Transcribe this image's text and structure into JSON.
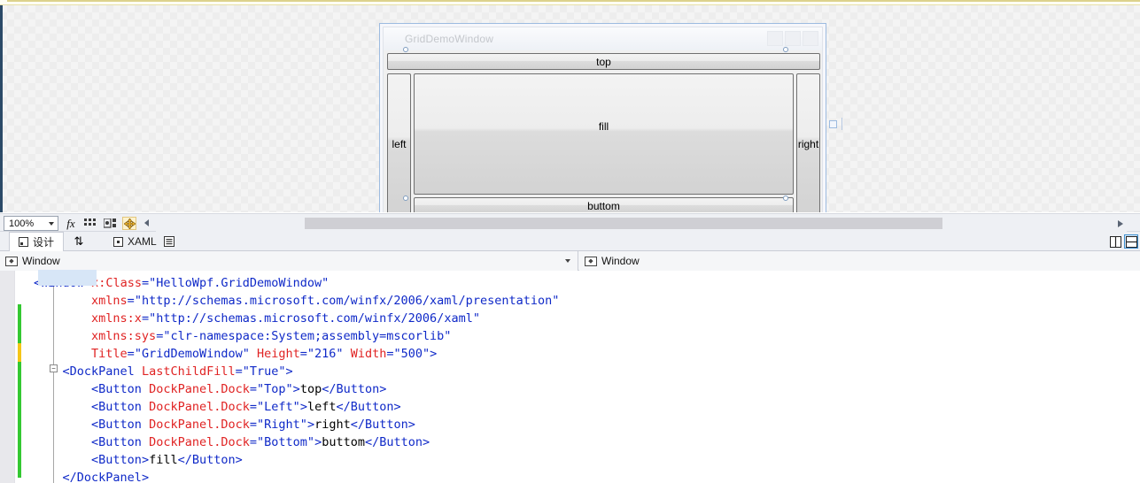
{
  "designer": {
    "window_title": "GridDemoWindow",
    "buttons": {
      "top": "top",
      "left": "left",
      "right": "right",
      "bottom": "buttom",
      "fill": "fill"
    }
  },
  "toolbar": {
    "zoom_value": "100%",
    "icons": [
      {
        "name": "fx-icon",
        "glyph": "fx"
      },
      {
        "name": "grid-icon",
        "glyph": "▒"
      },
      {
        "name": "snapping-icon",
        "glyph": "▨"
      },
      {
        "name": "alignment-icon",
        "glyph": "✧"
      }
    ],
    "overflow_label": "◂"
  },
  "tabs": {
    "design_label": "设计",
    "xaml_label": "XAML",
    "swap_label": "⇅",
    "outline_label": "▤",
    "split_vertical_label": "|",
    "split_horizontal_label": "—"
  },
  "navbar": {
    "left_value": "Window",
    "right_value": "Window"
  },
  "code": {
    "lines": [
      [
        {
          "t": "punct",
          "s": "<"
        },
        {
          "t": "tag",
          "s": "Window"
        },
        {
          "t": "txt",
          "s": " "
        },
        {
          "t": "attr",
          "s": "x:Class"
        },
        {
          "t": "punct",
          "s": "="
        },
        {
          "t": "val",
          "s": "\"HelloWpf.GridDemoWindow\""
        }
      ],
      [
        {
          "t": "txt",
          "s": "        "
        },
        {
          "t": "attr",
          "s": "xmlns"
        },
        {
          "t": "punct",
          "s": "="
        },
        {
          "t": "val",
          "s": "\"http://schemas.microsoft.com/winfx/2006/xaml/presentation\""
        }
      ],
      [
        {
          "t": "txt",
          "s": "        "
        },
        {
          "t": "attr",
          "s": "xmlns:x"
        },
        {
          "t": "punct",
          "s": "="
        },
        {
          "t": "val",
          "s": "\"http://schemas.microsoft.com/winfx/2006/xaml\""
        }
      ],
      [
        {
          "t": "txt",
          "s": "        "
        },
        {
          "t": "attr",
          "s": "xmlns:sys"
        },
        {
          "t": "punct",
          "s": "="
        },
        {
          "t": "val",
          "s": "\"clr-namespace:System;assembly=mscorlib\""
        }
      ],
      [
        {
          "t": "txt",
          "s": "        "
        },
        {
          "t": "attr",
          "s": "Title"
        },
        {
          "t": "punct",
          "s": "="
        },
        {
          "t": "val",
          "s": "\"GridDemoWindow\""
        },
        {
          "t": "txt",
          "s": " "
        },
        {
          "t": "attr",
          "s": "Height"
        },
        {
          "t": "punct",
          "s": "="
        },
        {
          "t": "val",
          "s": "\"216\""
        },
        {
          "t": "txt",
          "s": " "
        },
        {
          "t": "attr",
          "s": "Width"
        },
        {
          "t": "punct",
          "s": "="
        },
        {
          "t": "val",
          "s": "\"500\""
        },
        {
          "t": "punct",
          "s": ">"
        }
      ],
      [
        {
          "t": "txt",
          "s": "    "
        },
        {
          "t": "punct",
          "s": "<"
        },
        {
          "t": "tag",
          "s": "DockPanel"
        },
        {
          "t": "txt",
          "s": " "
        },
        {
          "t": "attr",
          "s": "LastChildFill"
        },
        {
          "t": "punct",
          "s": "="
        },
        {
          "t": "val",
          "s": "\"True\""
        },
        {
          "t": "punct",
          "s": ">"
        }
      ],
      [
        {
          "t": "txt",
          "s": "        "
        },
        {
          "t": "punct",
          "s": "<"
        },
        {
          "t": "tag",
          "s": "Button"
        },
        {
          "t": "txt",
          "s": " "
        },
        {
          "t": "attr",
          "s": "DockPanel.Dock"
        },
        {
          "t": "punct",
          "s": "="
        },
        {
          "t": "val",
          "s": "\"Top\""
        },
        {
          "t": "punct",
          "s": ">"
        },
        {
          "t": "txt",
          "s": "top"
        },
        {
          "t": "punct",
          "s": "</"
        },
        {
          "t": "tag",
          "s": "Button"
        },
        {
          "t": "punct",
          "s": ">"
        }
      ],
      [
        {
          "t": "txt",
          "s": "        "
        },
        {
          "t": "punct",
          "s": "<"
        },
        {
          "t": "tag",
          "s": "Button"
        },
        {
          "t": "txt",
          "s": " "
        },
        {
          "t": "attr",
          "s": "DockPanel.Dock"
        },
        {
          "t": "punct",
          "s": "="
        },
        {
          "t": "val",
          "s": "\"Left\""
        },
        {
          "t": "punct",
          "s": ">"
        },
        {
          "t": "txt",
          "s": "left"
        },
        {
          "t": "punct",
          "s": "</"
        },
        {
          "t": "tag",
          "s": "Button"
        },
        {
          "t": "punct",
          "s": ">"
        }
      ],
      [
        {
          "t": "txt",
          "s": "        "
        },
        {
          "t": "punct",
          "s": "<"
        },
        {
          "t": "tag",
          "s": "Button"
        },
        {
          "t": "txt",
          "s": " "
        },
        {
          "t": "attr",
          "s": "DockPanel.Dock"
        },
        {
          "t": "punct",
          "s": "="
        },
        {
          "t": "val",
          "s": "\"Right\""
        },
        {
          "t": "punct",
          "s": ">"
        },
        {
          "t": "txt",
          "s": "right"
        },
        {
          "t": "punct",
          "s": "</"
        },
        {
          "t": "tag",
          "s": "Button"
        },
        {
          "t": "punct",
          "s": ">"
        }
      ],
      [
        {
          "t": "txt",
          "s": "        "
        },
        {
          "t": "punct",
          "s": "<"
        },
        {
          "t": "tag",
          "s": "Button"
        },
        {
          "t": "txt",
          "s": " "
        },
        {
          "t": "attr",
          "s": "DockPanel.Dock"
        },
        {
          "t": "punct",
          "s": "="
        },
        {
          "t": "val",
          "s": "\"Bottom\""
        },
        {
          "t": "punct",
          "s": ">"
        },
        {
          "t": "txt",
          "s": "buttom"
        },
        {
          "t": "punct",
          "s": "</"
        },
        {
          "t": "tag",
          "s": "Button"
        },
        {
          "t": "punct",
          "s": ">"
        }
      ],
      [
        {
          "t": "txt",
          "s": "        "
        },
        {
          "t": "punct",
          "s": "<"
        },
        {
          "t": "tag",
          "s": "Button"
        },
        {
          "t": "punct",
          "s": ">"
        },
        {
          "t": "txt",
          "s": "fill"
        },
        {
          "t": "punct",
          "s": "</"
        },
        {
          "t": "tag",
          "s": "Button"
        },
        {
          "t": "punct",
          "s": ">"
        }
      ],
      [
        {
          "t": "txt",
          "s": "    "
        },
        {
          "t": "punct",
          "s": "</"
        },
        {
          "t": "tag",
          "s": "DockPanel"
        },
        {
          "t": "punct",
          "s": ">"
        }
      ]
    ]
  },
  "colors": {
    "tag": "#0f29c8",
    "attribute": "#e02323",
    "value": "#0f29c8",
    "text": "#000000",
    "change_bar": "#34c832",
    "modified_bar": "#f5c518",
    "selection": "#9dbbe0"
  }
}
